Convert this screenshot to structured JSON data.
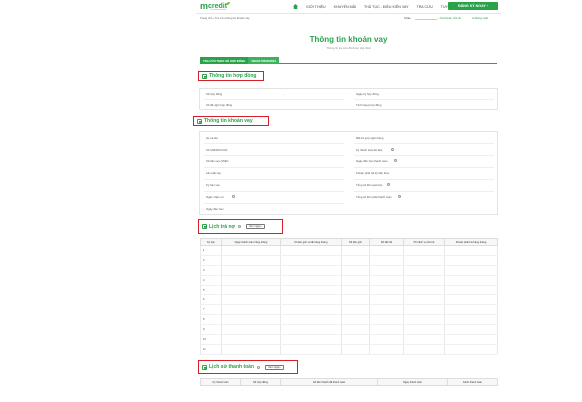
{
  "header": {
    "logo_main": "m",
    "logo_rest": "credit",
    "logo_tagline": "Tài chính cá nhân",
    "nav": [
      "GIỚI THIỆU",
      "KHUYẾN MÃI",
      "THỦ TỤC - ĐIỀU KIỆN VAY",
      "TRA CỨU",
      "TUYỂN DỤNG",
      "TƯ VẤN"
    ],
    "register_label": "ĐĂNG KÝ NGAY ›",
    "breadcrumb": "Trang chủ › Tra cứu thông tin khoản vay",
    "greeting": "Chào",
    "account_link": "› Tài khoản của tôi",
    "logout_link": "⊖ Đăng xuất"
  },
  "page": {
    "title": "Thông tin khoản vay",
    "subtitle": "Thông tin tra cứu đã được cập nhật"
  },
  "tabs": [
    {
      "label": "TRA CỨU THEO SỐ HỢP ĐỒNG",
      "active": true
    },
    {
      "label": "0000117050000624",
      "active": false
    }
  ],
  "contract": {
    "heading": "Thông tin hợp đồng",
    "fields_left": [
      "Số hợp đồng",
      "Số đề nghị hợp đồng"
    ],
    "fields_right": [
      "Ngày ký hợp đồng",
      "Tình trạng hợp đồng"
    ],
    "value_dash": "-"
  },
  "loan": {
    "heading": "Thông tin khoản vay",
    "fields_left": [
      "Họ và tên",
      "Số CMND/CCCD",
      "Số tiền vay (VNĐ)",
      "Lãi suất vay",
      "Kỳ hạn vay",
      "Ngày nhận nợ",
      "Ngày đáo hạn"
    ],
    "fields_right": [
      "Mã trả góp ngân hàng",
      "Kỳ thanh toán kế tiếp",
      "Ngày đến hạn thanh toán",
      "Khoản phải trả kỳ tiếp theo",
      "Tổng số tiền quá hạn",
      "Tổng số tiền phải thanh toán"
    ]
  },
  "schedule": {
    "heading": "Lịch trả nợ",
    "view_label": "Xem ngay ›",
    "columns": [
      "Kỳ hạn",
      "Ngày thanh toán hàng tháng",
      "Khoản gốc và lãi hàng tháng",
      "Số tiền gốc",
      "Số tiền lãi",
      "Phí dịch vụ thu hộ",
      "Khoản phải trả hàng tháng"
    ],
    "rows": [
      "1",
      "2",
      "3",
      "4",
      "5",
      "6",
      "7",
      "8",
      "9",
      "10",
      "11"
    ]
  },
  "history": {
    "heading": "Lịch sử thanh toán",
    "view_label": "Xem ngay ›",
    "columns": [
      "Kỳ thanh toán",
      "Số hợp đồng",
      "Số tiền khách đã thanh toán",
      "Ngày thanh toán",
      "Kênh thanh toán"
    ]
  },
  "colors": {
    "brand_green": "#2aa24a",
    "highlight_red": "#d61f26"
  }
}
